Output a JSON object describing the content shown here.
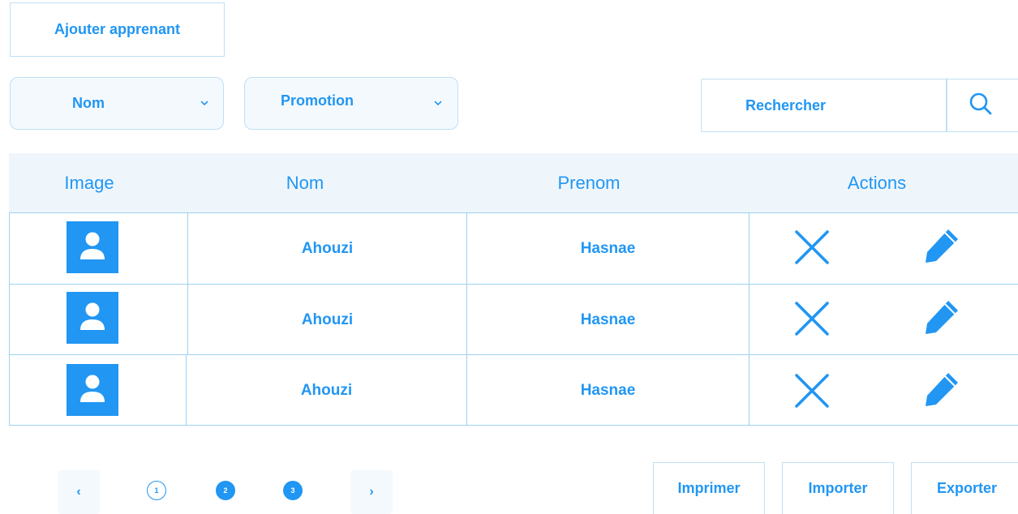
{
  "toolbar": {
    "add_label": "Ajouter apprenant"
  },
  "filters": {
    "nom": {
      "label": "Nom",
      "icon": "chevron-down-icon"
    },
    "promotion": {
      "label": "Promotion",
      "icon": "chevron-down-icon"
    }
  },
  "search": {
    "placeholder": "Rechercher",
    "icon": "search-icon"
  },
  "table": {
    "headers": [
      "Image",
      "Nom",
      "Prenom",
      "Actions"
    ],
    "rows": [
      {
        "avatar_icon": "user-avatar-icon",
        "nom": "Ahouzi",
        "prenom": "Hasnae",
        "delete_icon": "close-icon",
        "edit_icon": "pencil-icon"
      },
      {
        "avatar_icon": "user-avatar-icon",
        "nom": "Ahouzi",
        "prenom": "Hasnae",
        "delete_icon": "close-icon",
        "edit_icon": "pencil-icon"
      },
      {
        "avatar_icon": "user-avatar-icon",
        "nom": "Ahouzi",
        "prenom": "Hasnae",
        "delete_icon": "close-icon",
        "edit_icon": "pencil-icon"
      }
    ]
  },
  "pagination": {
    "prev": "‹",
    "next": "›",
    "pages": [
      "1",
      "2",
      "3"
    ]
  },
  "actions": {
    "print": "Imprimer",
    "import": "Importer",
    "export": "Exporter"
  },
  "colors": {
    "accent": "#2196f3",
    "border": "#bfe0f4",
    "header_bg": "#eef6fc",
    "filter_bg": "#f4f9fd"
  }
}
